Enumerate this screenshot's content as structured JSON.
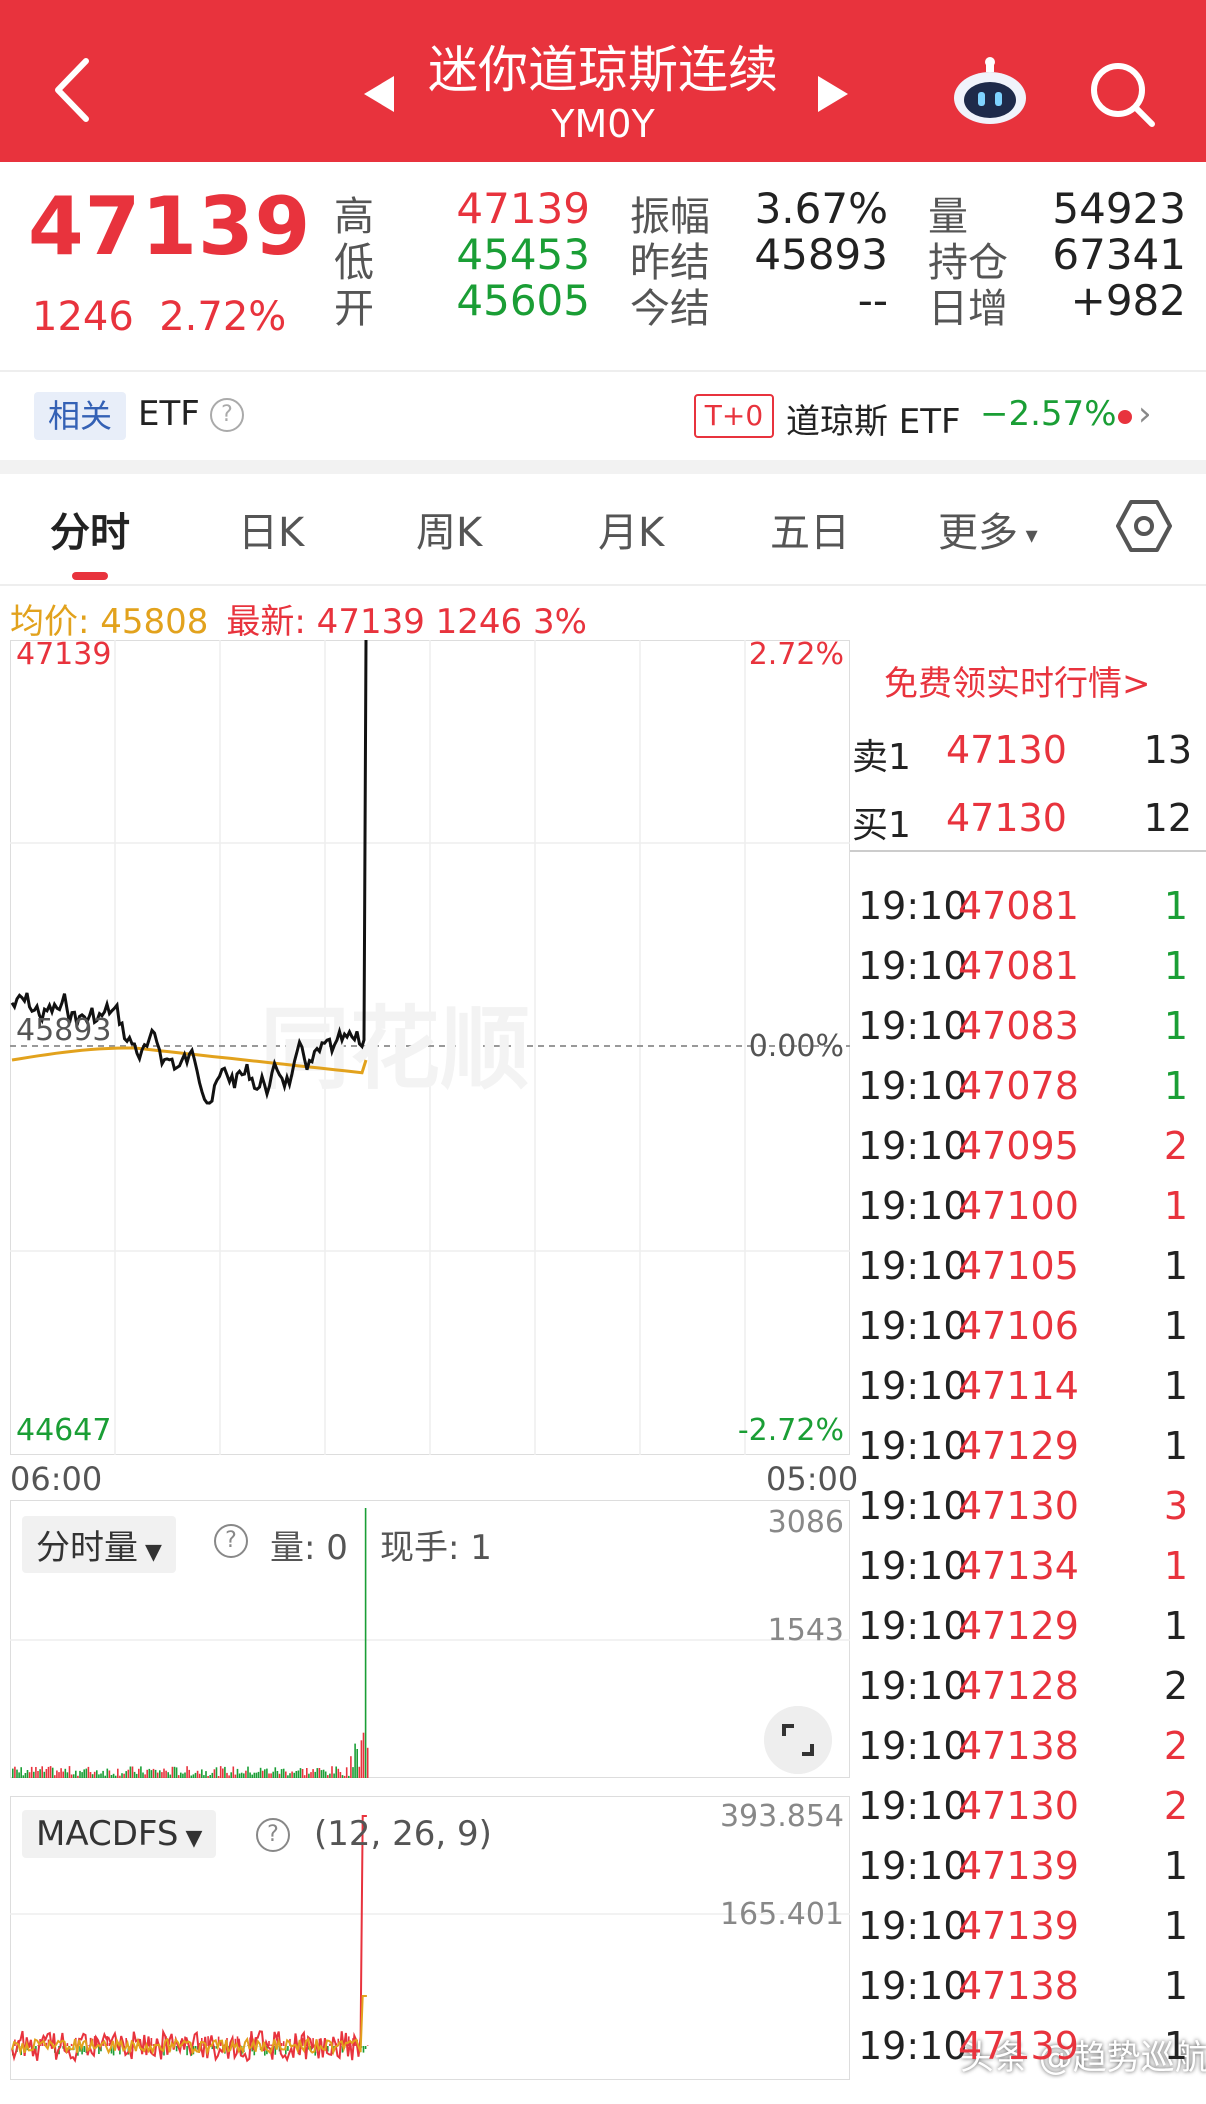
{
  "header": {
    "title": "迷你道琼斯连续",
    "code": "YM0Y"
  },
  "quote": {
    "last": "47139",
    "change": "1246",
    "change_pct": "2.72%",
    "rows": [
      {
        "l1": "高",
        "v1": "47139",
        "c1": "red",
        "l2": "振幅",
        "v2": "3.67%",
        "c2": "dark",
        "l3": "量",
        "v3": "54923",
        "c3": "dark"
      },
      {
        "l1": "低",
        "v1": "45453",
        "c1": "green",
        "l2": "昨结",
        "v2": "45893",
        "c2": "dark",
        "l3": "持仓",
        "v3": "67341",
        "c3": "dark"
      },
      {
        "l1": "开",
        "v1": "45605",
        "c1": "green",
        "l2": "今结",
        "v2": "--",
        "c2": "dark",
        "l3": "日增",
        "v3": "+982",
        "c3": "dark"
      }
    ]
  },
  "etf": {
    "tag": "相关",
    "label": "ETF",
    "t0": "T+0",
    "name": "道琼斯 ETF",
    "pct": "−2.57%"
  },
  "tabs": [
    "分时",
    "日K",
    "周K",
    "月K",
    "五日",
    "更多"
  ],
  "stats": {
    "avg": "均价: 45808",
    "latest": "最新: 47139  1246  3%"
  },
  "main_chart": {
    "top_price": "47139",
    "bottom_price": "44647",
    "mid_price": "45893",
    "top_pct": "2.72%",
    "mid_pct": "0.00%",
    "bottom_pct": "-2.72%",
    "time_start": "06:00",
    "time_end": "05:00",
    "watermark": "同花顺",
    "colors": {
      "price": "#111111",
      "avg": "#e2a21d",
      "up": "#e8333d",
      "down": "#1a9e35"
    }
  },
  "volume": {
    "selector": "分时量",
    "vol_label": "量: 0",
    "hand_label": "现手: 1",
    "y_top": "3086",
    "y_mid": "1543"
  },
  "macd": {
    "selector": "MACDFS",
    "params": "(12, 26, 9)",
    "y_top": "393.854",
    "y_mid": "165.401"
  },
  "panel": {
    "free_quote": "免费领实时行情>",
    "orderbook": [
      {
        "label": "卖1",
        "price": "47130",
        "qty": "13"
      },
      {
        "label": "买1",
        "price": "47130",
        "qty": "12"
      }
    ],
    "trades": [
      {
        "time": "19:10",
        "price": "47081",
        "qty": "1",
        "color": "green"
      },
      {
        "time": "19:10",
        "price": "47081",
        "qty": "1",
        "color": "green"
      },
      {
        "time": "19:10",
        "price": "47083",
        "qty": "1",
        "color": "green"
      },
      {
        "time": "19:10",
        "price": "47078",
        "qty": "1",
        "color": "green"
      },
      {
        "time": "19:10",
        "price": "47095",
        "qty": "2",
        "color": "red"
      },
      {
        "time": "19:10",
        "price": "47100",
        "qty": "1",
        "color": "red"
      },
      {
        "time": "19:10",
        "price": "47105",
        "qty": "1",
        "color": "dark"
      },
      {
        "time": "19:10",
        "price": "47106",
        "qty": "1",
        "color": "dark"
      },
      {
        "time": "19:10",
        "price": "47114",
        "qty": "1",
        "color": "dark"
      },
      {
        "time": "19:10",
        "price": "47129",
        "qty": "1",
        "color": "dark"
      },
      {
        "time": "19:10",
        "price": "47130",
        "qty": "3",
        "color": "red"
      },
      {
        "time": "19:10",
        "price": "47134",
        "qty": "1",
        "color": "red"
      },
      {
        "time": "19:10",
        "price": "47129",
        "qty": "1",
        "color": "dark"
      },
      {
        "time": "19:10",
        "price": "47128",
        "qty": "2",
        "color": "dark"
      },
      {
        "time": "19:10",
        "price": "47138",
        "qty": "2",
        "color": "red"
      },
      {
        "time": "19:10",
        "price": "47130",
        "qty": "2",
        "color": "red"
      },
      {
        "time": "19:10",
        "price": "47139",
        "qty": "1",
        "color": "dark"
      },
      {
        "time": "19:10",
        "price": "47139",
        "qty": "1",
        "color": "dark"
      },
      {
        "time": "19:10",
        "price": "47138",
        "qty": "1",
        "color": "dark"
      },
      {
        "time": "19:10",
        "price": "47139",
        "qty": "1",
        "color": "dark"
      }
    ]
  },
  "watermark": "头条 @趋势巡航"
}
